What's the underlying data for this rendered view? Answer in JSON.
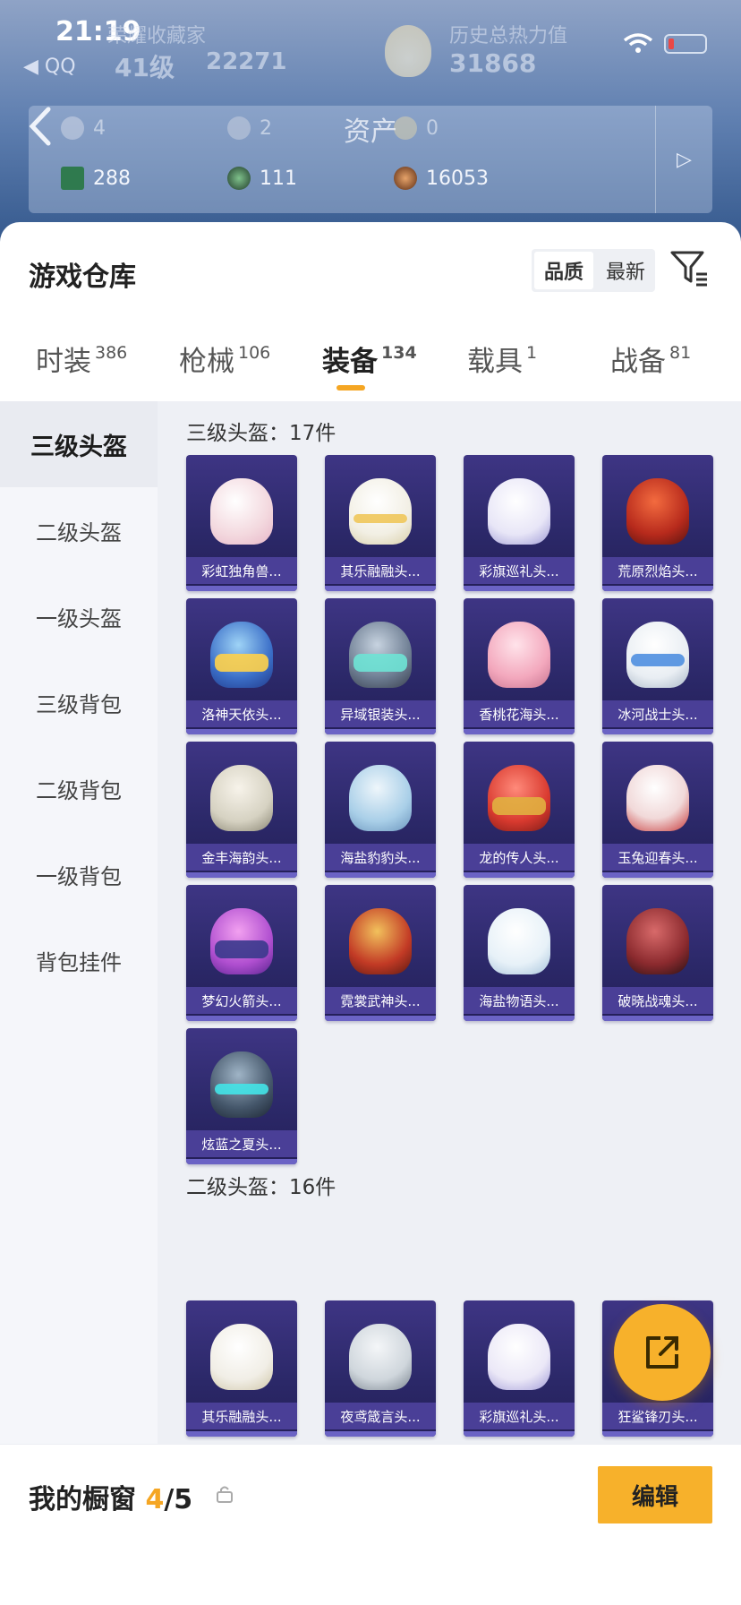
{
  "status_bar": {
    "time": "21:19",
    "back_app": "◀ QQ"
  },
  "header": {
    "collector_label": "荣耀收藏家",
    "level": "41级",
    "coins": "22271",
    "history_heat_label": "历史总热力值",
    "history_heat_value": "31868",
    "assets_title": "资产",
    "assets_row1": [
      "4",
      "2",
      "0"
    ],
    "assets_row2": [
      "288",
      "111",
      "16053"
    ],
    "assets_more": "▷"
  },
  "panel": {
    "title": "游戏仓库",
    "sort_quality": "品质",
    "sort_newest": "最新"
  },
  "tabs": [
    {
      "label": "时装",
      "count": "386"
    },
    {
      "label": "枪械",
      "count": "106"
    },
    {
      "label": "装备",
      "count": "134"
    },
    {
      "label": "载具",
      "count": "1"
    },
    {
      "label": "战备",
      "count": "81"
    }
  ],
  "sidebar": {
    "items": [
      "三级头盔",
      "二级头盔",
      "一级头盔",
      "三级背包",
      "二级背包",
      "一级背包",
      "背包挂件"
    ],
    "selected": "三级头盔"
  },
  "sections": [
    {
      "title": "三级头盔：17件"
    },
    {
      "title": "二级头盔：16件"
    }
  ],
  "items_lvl3": [
    "彩虹独角兽...",
    "其乐融融头...",
    "彩旗巡礼头...",
    "荒原烈焰头...",
    "洛神天依头...",
    "异域银装头...",
    "香桃花海头...",
    "冰河战士头...",
    "金丰海韵头...",
    "海盐豹豹头...",
    "龙的传人头...",
    "玉兔迎春头...",
    "梦幻火箭头...",
    "霓裳武神头...",
    "海盐物语头...",
    "破晓战魂头...",
    "炫蓝之夏头..."
  ],
  "items_lvl2": [
    "其乐融融头...",
    "夜鸢箴言头...",
    "彩旗巡礼头...",
    "狂鲨锋刃头..."
  ],
  "bottom": {
    "title": "我的橱窗",
    "count_current": "4",
    "count_total": "/5",
    "edit_label": "编辑"
  },
  "colors": {
    "accent": "#f7b12b",
    "card": "#2b2868",
    "card_label": "#4a3f97"
  }
}
